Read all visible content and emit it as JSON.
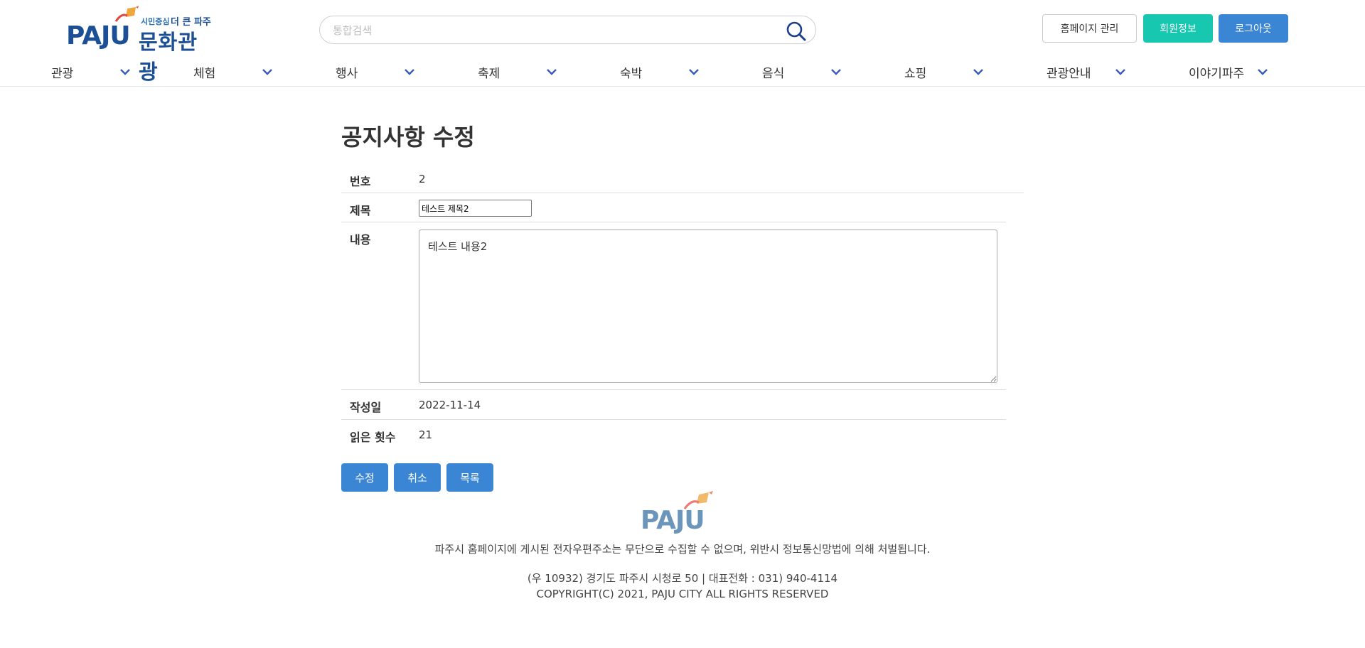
{
  "header": {
    "logo": {
      "brand": "PAJU",
      "tag_small": "시민중심",
      "tag_main": "더 큰 파주",
      "title": "문화관광"
    },
    "search": {
      "placeholder": "통합검색"
    },
    "buttons": {
      "admin": "홈페이지 관리",
      "member": "회원정보",
      "logout": "로그아웃"
    },
    "colors": {
      "member_bg": "#18c7b0",
      "logout_bg": "#3a86d4",
      "brand": "#1c4f96"
    }
  },
  "nav": {
    "items": [
      {
        "label": "관광"
      },
      {
        "label": "체험"
      },
      {
        "label": "행사"
      },
      {
        "label": "축제"
      },
      {
        "label": "숙박"
      },
      {
        "label": "음식"
      },
      {
        "label": "쇼핑"
      },
      {
        "label": "관광안내"
      },
      {
        "label": "이야기파주"
      }
    ]
  },
  "page": {
    "title": "공지사항 수정",
    "fields": {
      "number": {
        "label": "번호",
        "value": "2"
      },
      "subject": {
        "label": "제목",
        "value": "테스트 제목2"
      },
      "content": {
        "label": "내용",
        "value": "테스트 내용2"
      },
      "date": {
        "label": "작성일",
        "value": "2022-11-14"
      },
      "views": {
        "label": "읽은 횟수",
        "value": "21"
      }
    },
    "actions": {
      "edit": "수정",
      "cancel": "취소",
      "list": "목록"
    }
  },
  "footer": {
    "logo": "PAJU",
    "notice": "파주시 홈페이지에 게시된 전자우편주소는 무단으로 수집할 수 없으며, 위반시 정보통신망법에 의해 처벌됩니다.",
    "address": "(우 10932) 경기도 파주시 시청로 50 | 대표전화 : 031) 940-4114",
    "copyright": "COPYRIGHT(C) 2021, PAJU CITY ALL RIGHTS RESERVED"
  }
}
